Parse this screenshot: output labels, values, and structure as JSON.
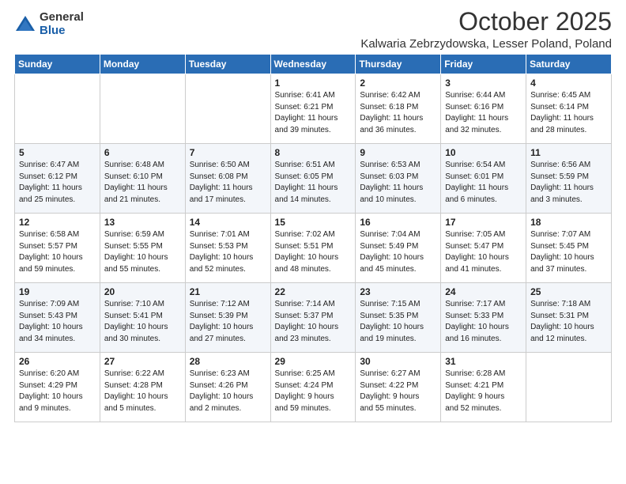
{
  "header": {
    "logo_general": "General",
    "logo_blue": "Blue",
    "month": "October 2025",
    "location": "Kalwaria Zebrzydowska, Lesser Poland, Poland"
  },
  "weekdays": [
    "Sunday",
    "Monday",
    "Tuesday",
    "Wednesday",
    "Thursday",
    "Friday",
    "Saturday"
  ],
  "weeks": [
    [
      {
        "day": "",
        "info": ""
      },
      {
        "day": "",
        "info": ""
      },
      {
        "day": "",
        "info": ""
      },
      {
        "day": "1",
        "info": "Sunrise: 6:41 AM\nSunset: 6:21 PM\nDaylight: 11 hours\nand 39 minutes."
      },
      {
        "day": "2",
        "info": "Sunrise: 6:42 AM\nSunset: 6:18 PM\nDaylight: 11 hours\nand 36 minutes."
      },
      {
        "day": "3",
        "info": "Sunrise: 6:44 AM\nSunset: 6:16 PM\nDaylight: 11 hours\nand 32 minutes."
      },
      {
        "day": "4",
        "info": "Sunrise: 6:45 AM\nSunset: 6:14 PM\nDaylight: 11 hours\nand 28 minutes."
      }
    ],
    [
      {
        "day": "5",
        "info": "Sunrise: 6:47 AM\nSunset: 6:12 PM\nDaylight: 11 hours\nand 25 minutes."
      },
      {
        "day": "6",
        "info": "Sunrise: 6:48 AM\nSunset: 6:10 PM\nDaylight: 11 hours\nand 21 minutes."
      },
      {
        "day": "7",
        "info": "Sunrise: 6:50 AM\nSunset: 6:08 PM\nDaylight: 11 hours\nand 17 minutes."
      },
      {
        "day": "8",
        "info": "Sunrise: 6:51 AM\nSunset: 6:05 PM\nDaylight: 11 hours\nand 14 minutes."
      },
      {
        "day": "9",
        "info": "Sunrise: 6:53 AM\nSunset: 6:03 PM\nDaylight: 11 hours\nand 10 minutes."
      },
      {
        "day": "10",
        "info": "Sunrise: 6:54 AM\nSunset: 6:01 PM\nDaylight: 11 hours\nand 6 minutes."
      },
      {
        "day": "11",
        "info": "Sunrise: 6:56 AM\nSunset: 5:59 PM\nDaylight: 11 hours\nand 3 minutes."
      }
    ],
    [
      {
        "day": "12",
        "info": "Sunrise: 6:58 AM\nSunset: 5:57 PM\nDaylight: 10 hours\nand 59 minutes."
      },
      {
        "day": "13",
        "info": "Sunrise: 6:59 AM\nSunset: 5:55 PM\nDaylight: 10 hours\nand 55 minutes."
      },
      {
        "day": "14",
        "info": "Sunrise: 7:01 AM\nSunset: 5:53 PM\nDaylight: 10 hours\nand 52 minutes."
      },
      {
        "day": "15",
        "info": "Sunrise: 7:02 AM\nSunset: 5:51 PM\nDaylight: 10 hours\nand 48 minutes."
      },
      {
        "day": "16",
        "info": "Sunrise: 7:04 AM\nSunset: 5:49 PM\nDaylight: 10 hours\nand 45 minutes."
      },
      {
        "day": "17",
        "info": "Sunrise: 7:05 AM\nSunset: 5:47 PM\nDaylight: 10 hours\nand 41 minutes."
      },
      {
        "day": "18",
        "info": "Sunrise: 7:07 AM\nSunset: 5:45 PM\nDaylight: 10 hours\nand 37 minutes."
      }
    ],
    [
      {
        "day": "19",
        "info": "Sunrise: 7:09 AM\nSunset: 5:43 PM\nDaylight: 10 hours\nand 34 minutes."
      },
      {
        "day": "20",
        "info": "Sunrise: 7:10 AM\nSunset: 5:41 PM\nDaylight: 10 hours\nand 30 minutes."
      },
      {
        "day": "21",
        "info": "Sunrise: 7:12 AM\nSunset: 5:39 PM\nDaylight: 10 hours\nand 27 minutes."
      },
      {
        "day": "22",
        "info": "Sunrise: 7:14 AM\nSunset: 5:37 PM\nDaylight: 10 hours\nand 23 minutes."
      },
      {
        "day": "23",
        "info": "Sunrise: 7:15 AM\nSunset: 5:35 PM\nDaylight: 10 hours\nand 19 minutes."
      },
      {
        "day": "24",
        "info": "Sunrise: 7:17 AM\nSunset: 5:33 PM\nDaylight: 10 hours\nand 16 minutes."
      },
      {
        "day": "25",
        "info": "Sunrise: 7:18 AM\nSunset: 5:31 PM\nDaylight: 10 hours\nand 12 minutes."
      }
    ],
    [
      {
        "day": "26",
        "info": "Sunrise: 6:20 AM\nSunset: 4:29 PM\nDaylight: 10 hours\nand 9 minutes."
      },
      {
        "day": "27",
        "info": "Sunrise: 6:22 AM\nSunset: 4:28 PM\nDaylight: 10 hours\nand 5 minutes."
      },
      {
        "day": "28",
        "info": "Sunrise: 6:23 AM\nSunset: 4:26 PM\nDaylight: 10 hours\nand 2 minutes."
      },
      {
        "day": "29",
        "info": "Sunrise: 6:25 AM\nSunset: 4:24 PM\nDaylight: 9 hours\nand 59 minutes."
      },
      {
        "day": "30",
        "info": "Sunrise: 6:27 AM\nSunset: 4:22 PM\nDaylight: 9 hours\nand 55 minutes."
      },
      {
        "day": "31",
        "info": "Sunrise: 6:28 AM\nSunset: 4:21 PM\nDaylight: 9 hours\nand 52 minutes."
      },
      {
        "day": "",
        "info": ""
      }
    ]
  ]
}
